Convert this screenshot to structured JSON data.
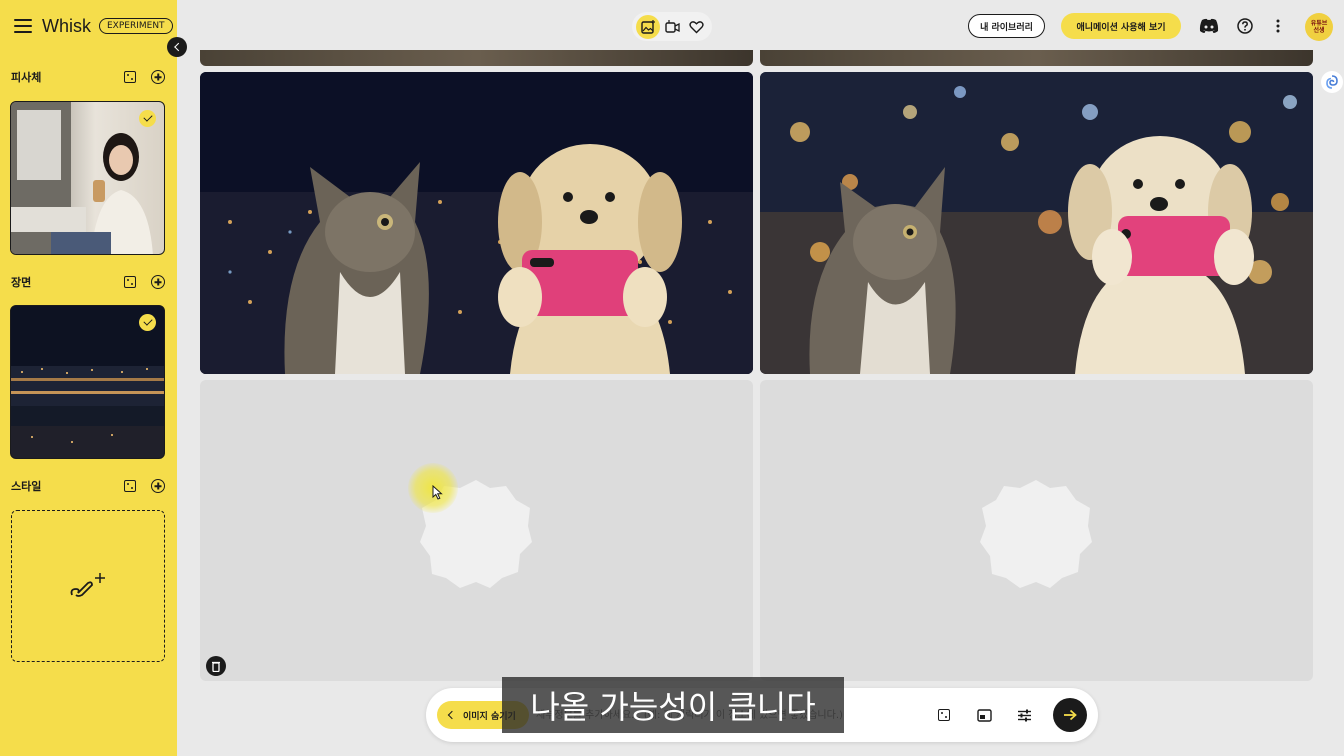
{
  "app": {
    "title": "Whisk",
    "badge": "EXPERIMENT"
  },
  "sidebar": {
    "subject": {
      "title": "피사체"
    },
    "scene": {
      "title": "장면"
    },
    "style": {
      "title": "스타일"
    }
  },
  "header": {
    "library_label": "내 라이브러리",
    "animation_label": "애니메이션 사용해 보기",
    "avatar_text_1": "유튜브",
    "avatar_text_2": "선생"
  },
  "prompt": {
    "hide_images_label": "이미지 숨기기",
    "placeholder": "세부정보를 추가하세요... (예: 제 캐릭터가 이 장소에 있으면 좋겠습니다.)"
  },
  "subtitle": "나올 가능성이 큽니다",
  "colors": {
    "accent": "#f5dd4b",
    "dark": "#1b1b1b",
    "placeholder": "#dcdcdc"
  }
}
